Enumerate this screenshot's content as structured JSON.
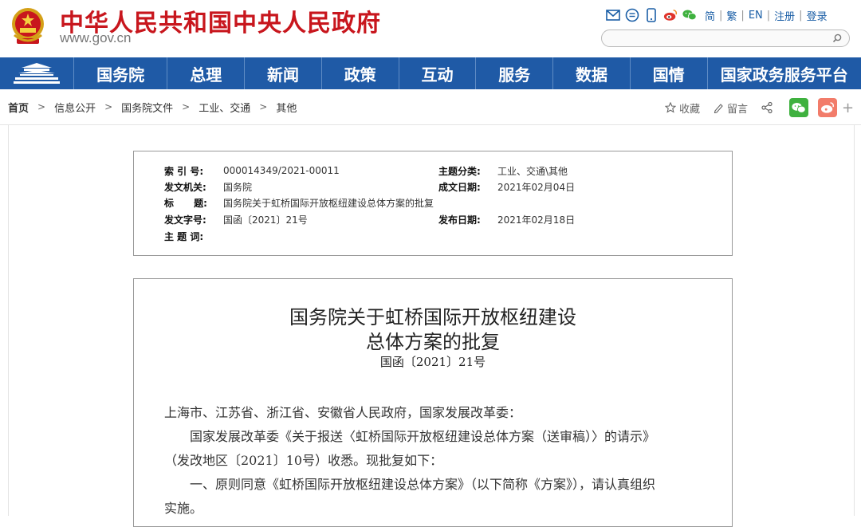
{
  "header": {
    "site_title": "中华人民共和国中央人民政府",
    "site_domain": "www.gov.cn",
    "links": {
      "simplified": "简",
      "traditional": "繁",
      "english": "EN",
      "register": "注册",
      "login": "登录"
    },
    "search_placeholder": ""
  },
  "nav": {
    "items": [
      "国务院",
      "总理",
      "新闻",
      "政策",
      "互动",
      "服务",
      "数据",
      "国情",
      "国家政务服务平台"
    ]
  },
  "breadcrumb": [
    "首页",
    "信息公开",
    "国务院文件",
    "工业、交通",
    "其他"
  ],
  "tools": {
    "favorite": "收藏",
    "comment": "留言"
  },
  "meta": {
    "index_label": "索 引 号:",
    "index_value": "000014349/2021-00011",
    "category_label": "主题分类:",
    "category_value": "工业、交通\\其他",
    "issuer_label": "发文机关:",
    "issuer_value": "国务院",
    "written_label": "成文日期:",
    "written_value": "2021年02月04日",
    "title_label": "标      题:",
    "title_value": "国务院关于虹桥国际开放枢纽建设总体方案的批复",
    "docno_label": "发文字号:",
    "docno_value": "国函〔2021〕21号",
    "published_label": "发布日期:",
    "published_value": "2021年02月18日",
    "keywords_label": "主 题 词:",
    "keywords_value": ""
  },
  "document": {
    "title_line1": "国务院关于虹桥国际开放枢纽建设",
    "title_line2": "总体方案的批复",
    "doc_number": "国函〔2021〕21号",
    "paragraphs": [
      "上海市、江苏省、浙江省、安徽省人民政府，国家发展改革委：",
      "　　国家发展改革委《关于报送〈虹桥国际开放枢纽建设总体方案（送审稿）〉的请示》",
      "（发改地区〔2021〕10号）收悉。现批复如下：",
      "　　一、原则同意《虹桥国际开放枢纽建设总体方案》（以下简称《方案》），请认真组织",
      "实施。"
    ]
  },
  "colors": {
    "brand_red": "#c8161d",
    "nav_blue": "#1f5aa6",
    "link_blue": "#1a5ea6",
    "wechat_green": "#3fb13f",
    "weibo_orange": "#f27c6a"
  }
}
